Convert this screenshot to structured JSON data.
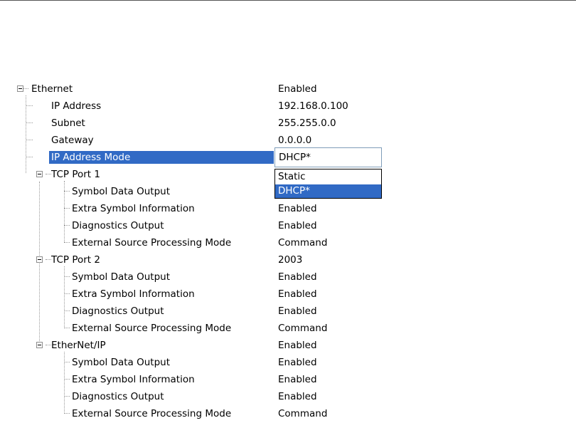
{
  "tree": {
    "rows": [
      {
        "label": "Ethernet",
        "value": "Enabled"
      },
      {
        "label": "IP Address",
        "value": "192.168.0.100"
      },
      {
        "label": "Subnet",
        "value": "255.255.0.0"
      },
      {
        "label": "Gateway",
        "value": "0.0.0.0"
      },
      {
        "label": "IP Address Mode",
        "value": "DHCP*"
      },
      {
        "label": "TCP Port 1",
        "value": ""
      },
      {
        "label": "Symbol Data Output",
        "value": ""
      },
      {
        "label": "Extra Symbol Information",
        "value": "Enabled"
      },
      {
        "label": "Diagnostics Output",
        "value": "Enabled"
      },
      {
        "label": "External Source Processing Mode",
        "value": "Command"
      },
      {
        "label": "TCP Port 2",
        "value": "2003"
      },
      {
        "label": "Symbol Data Output",
        "value": "Enabled"
      },
      {
        "label": "Extra Symbol Information",
        "value": "Enabled"
      },
      {
        "label": "Diagnostics Output",
        "value": "Enabled"
      },
      {
        "label": "External Source Processing Mode",
        "value": "Command"
      },
      {
        "label": "EtherNet/IP",
        "value": "Enabled"
      },
      {
        "label": "Symbol Data Output",
        "value": "Enabled"
      },
      {
        "label": "Extra Symbol Information",
        "value": "Enabled"
      },
      {
        "label": "Diagnostics Output",
        "value": "Enabled"
      },
      {
        "label": "External Source Processing Mode",
        "value": "Command"
      }
    ]
  },
  "ip_mode_combo": {
    "selected": "DHCP*",
    "options": [
      "Static",
      "DHCP*"
    ]
  },
  "colors": {
    "selection": "#316ac5",
    "tree_lines": "#999999",
    "combo_border": "#7f9db9"
  },
  "icons": {
    "collapse": "minus-box-icon"
  }
}
